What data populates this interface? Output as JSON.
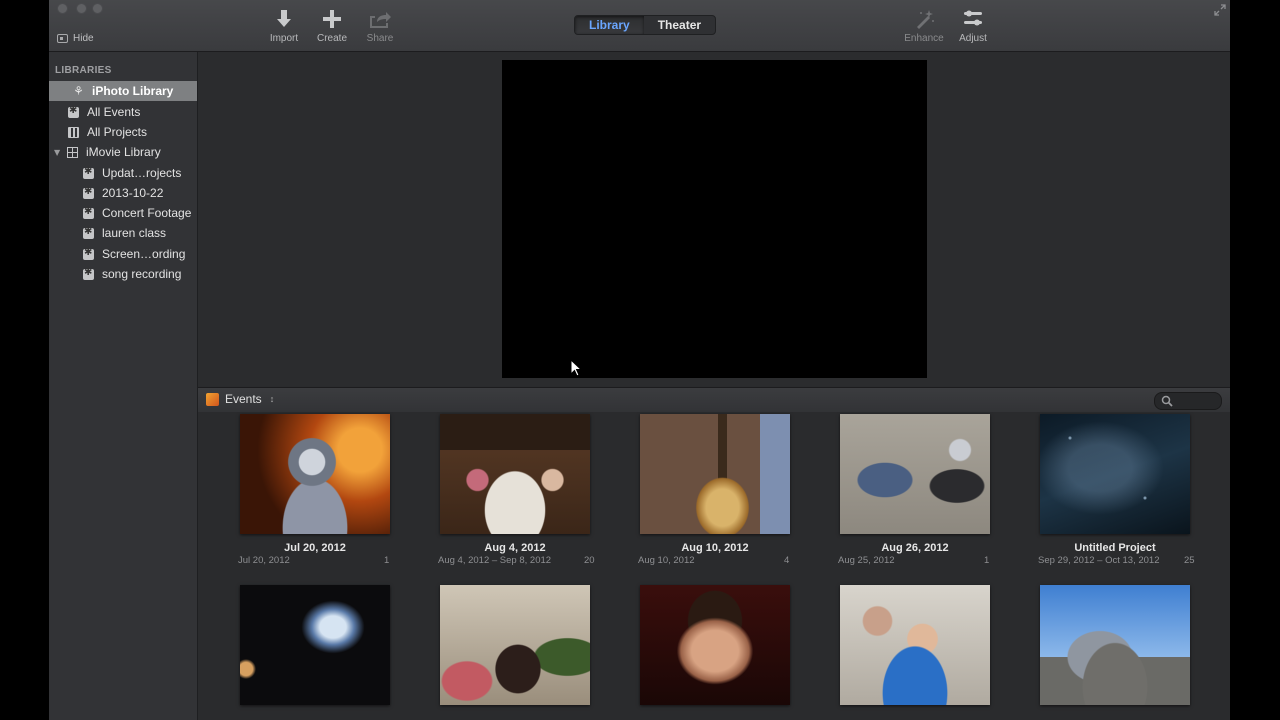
{
  "toolbar": {
    "hide_label": "Hide",
    "import_label": "Import",
    "create_label": "Create",
    "share_label": "Share",
    "enhance_label": "Enhance",
    "adjust_label": "Adjust",
    "tabs": [
      {
        "label": "Library",
        "active": true
      },
      {
        "label": "Theater",
        "active": false
      }
    ]
  },
  "sidebar": {
    "heading": "LIBRARIES",
    "items": [
      {
        "label": "iPhoto Library",
        "icon": "palm-icon",
        "selected": true
      },
      {
        "label": "All Events",
        "icon": "star-icon"
      },
      {
        "label": "All Projects",
        "icon": "film-icon"
      },
      {
        "label": "iMovie Library",
        "icon": "grid-icon"
      },
      {
        "label": "Updat…rojects",
        "icon": "star-icon"
      },
      {
        "label": "2013-10-22",
        "icon": "star-icon"
      },
      {
        "label": "Concert Footage",
        "icon": "star-icon"
      },
      {
        "label": "lauren class",
        "icon": "star-icon"
      },
      {
        "label": "Screen…ording",
        "icon": "star-icon"
      },
      {
        "label": "song recording",
        "icon": "star-icon"
      }
    ]
  },
  "events_bar": {
    "label": "Events",
    "sort_glyph": "↕"
  },
  "events": [
    {
      "title": "Jul 20, 2012",
      "dates": "Jul 20, 2012",
      "count": "1"
    },
    {
      "title": "Aug 4, 2012",
      "dates": "Aug 4, 2012 – Sep 8, 2012",
      "count": "20"
    },
    {
      "title": "Aug 10, 2012",
      "dates": "Aug 10, 2012",
      "count": "4"
    },
    {
      "title": "Aug 26, 2012",
      "dates": "Aug 25, 2012",
      "count": "1"
    },
    {
      "title": "Untitled Project",
      "dates": "Sep 29, 2012 – Oct 13, 2012",
      "count": "25"
    },
    {
      "title": "",
      "dates": "",
      "count": ""
    },
    {
      "title": "",
      "dates": "",
      "count": ""
    },
    {
      "title": "",
      "dates": "",
      "count": ""
    },
    {
      "title": "",
      "dates": "",
      "count": ""
    },
    {
      "title": "",
      "dates": "",
      "count": ""
    }
  ]
}
